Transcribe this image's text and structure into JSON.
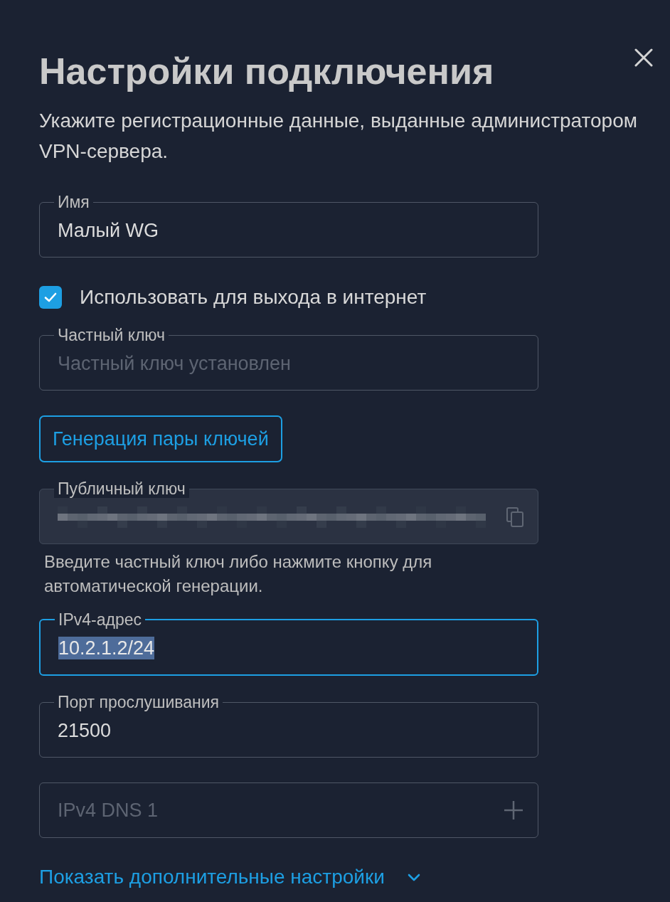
{
  "dialog": {
    "title": "Настройки подключения",
    "subtitle": "Укажите регистрационные данные, выданные администратором VPN-сервера."
  },
  "fields": [
    {
      "kind": "text",
      "label": "Имя",
      "value": "Малый WG",
      "focused": false,
      "value_selected": false
    },
    {
      "kind": "checkbox",
      "label": "Использовать для выхода в интернет",
      "checked": true
    },
    {
      "kind": "text",
      "label": "Частный ключ",
      "placeholder": "Частный ключ установлен",
      "focused": false
    },
    {
      "kind": "button",
      "label": "Генерация пары ключей"
    },
    {
      "kind": "readonly",
      "label": "Публичный ключ",
      "value_redacted": true,
      "helper": "Введите частный ключ либо нажмите кнопку для автоматической генерации."
    },
    {
      "kind": "text",
      "label": "IPv4-адрес",
      "value": "10.2.1.2/24",
      "focused": true,
      "value_selected": true
    },
    {
      "kind": "text",
      "label": "Порт прослушивания",
      "value": "21500",
      "focused": false,
      "value_selected": false
    },
    {
      "kind": "addable",
      "placeholder": "IPv4 DNS 1"
    }
  ],
  "more_link": {
    "label": "Показать дополнительные настройки",
    "expanded": false
  }
}
